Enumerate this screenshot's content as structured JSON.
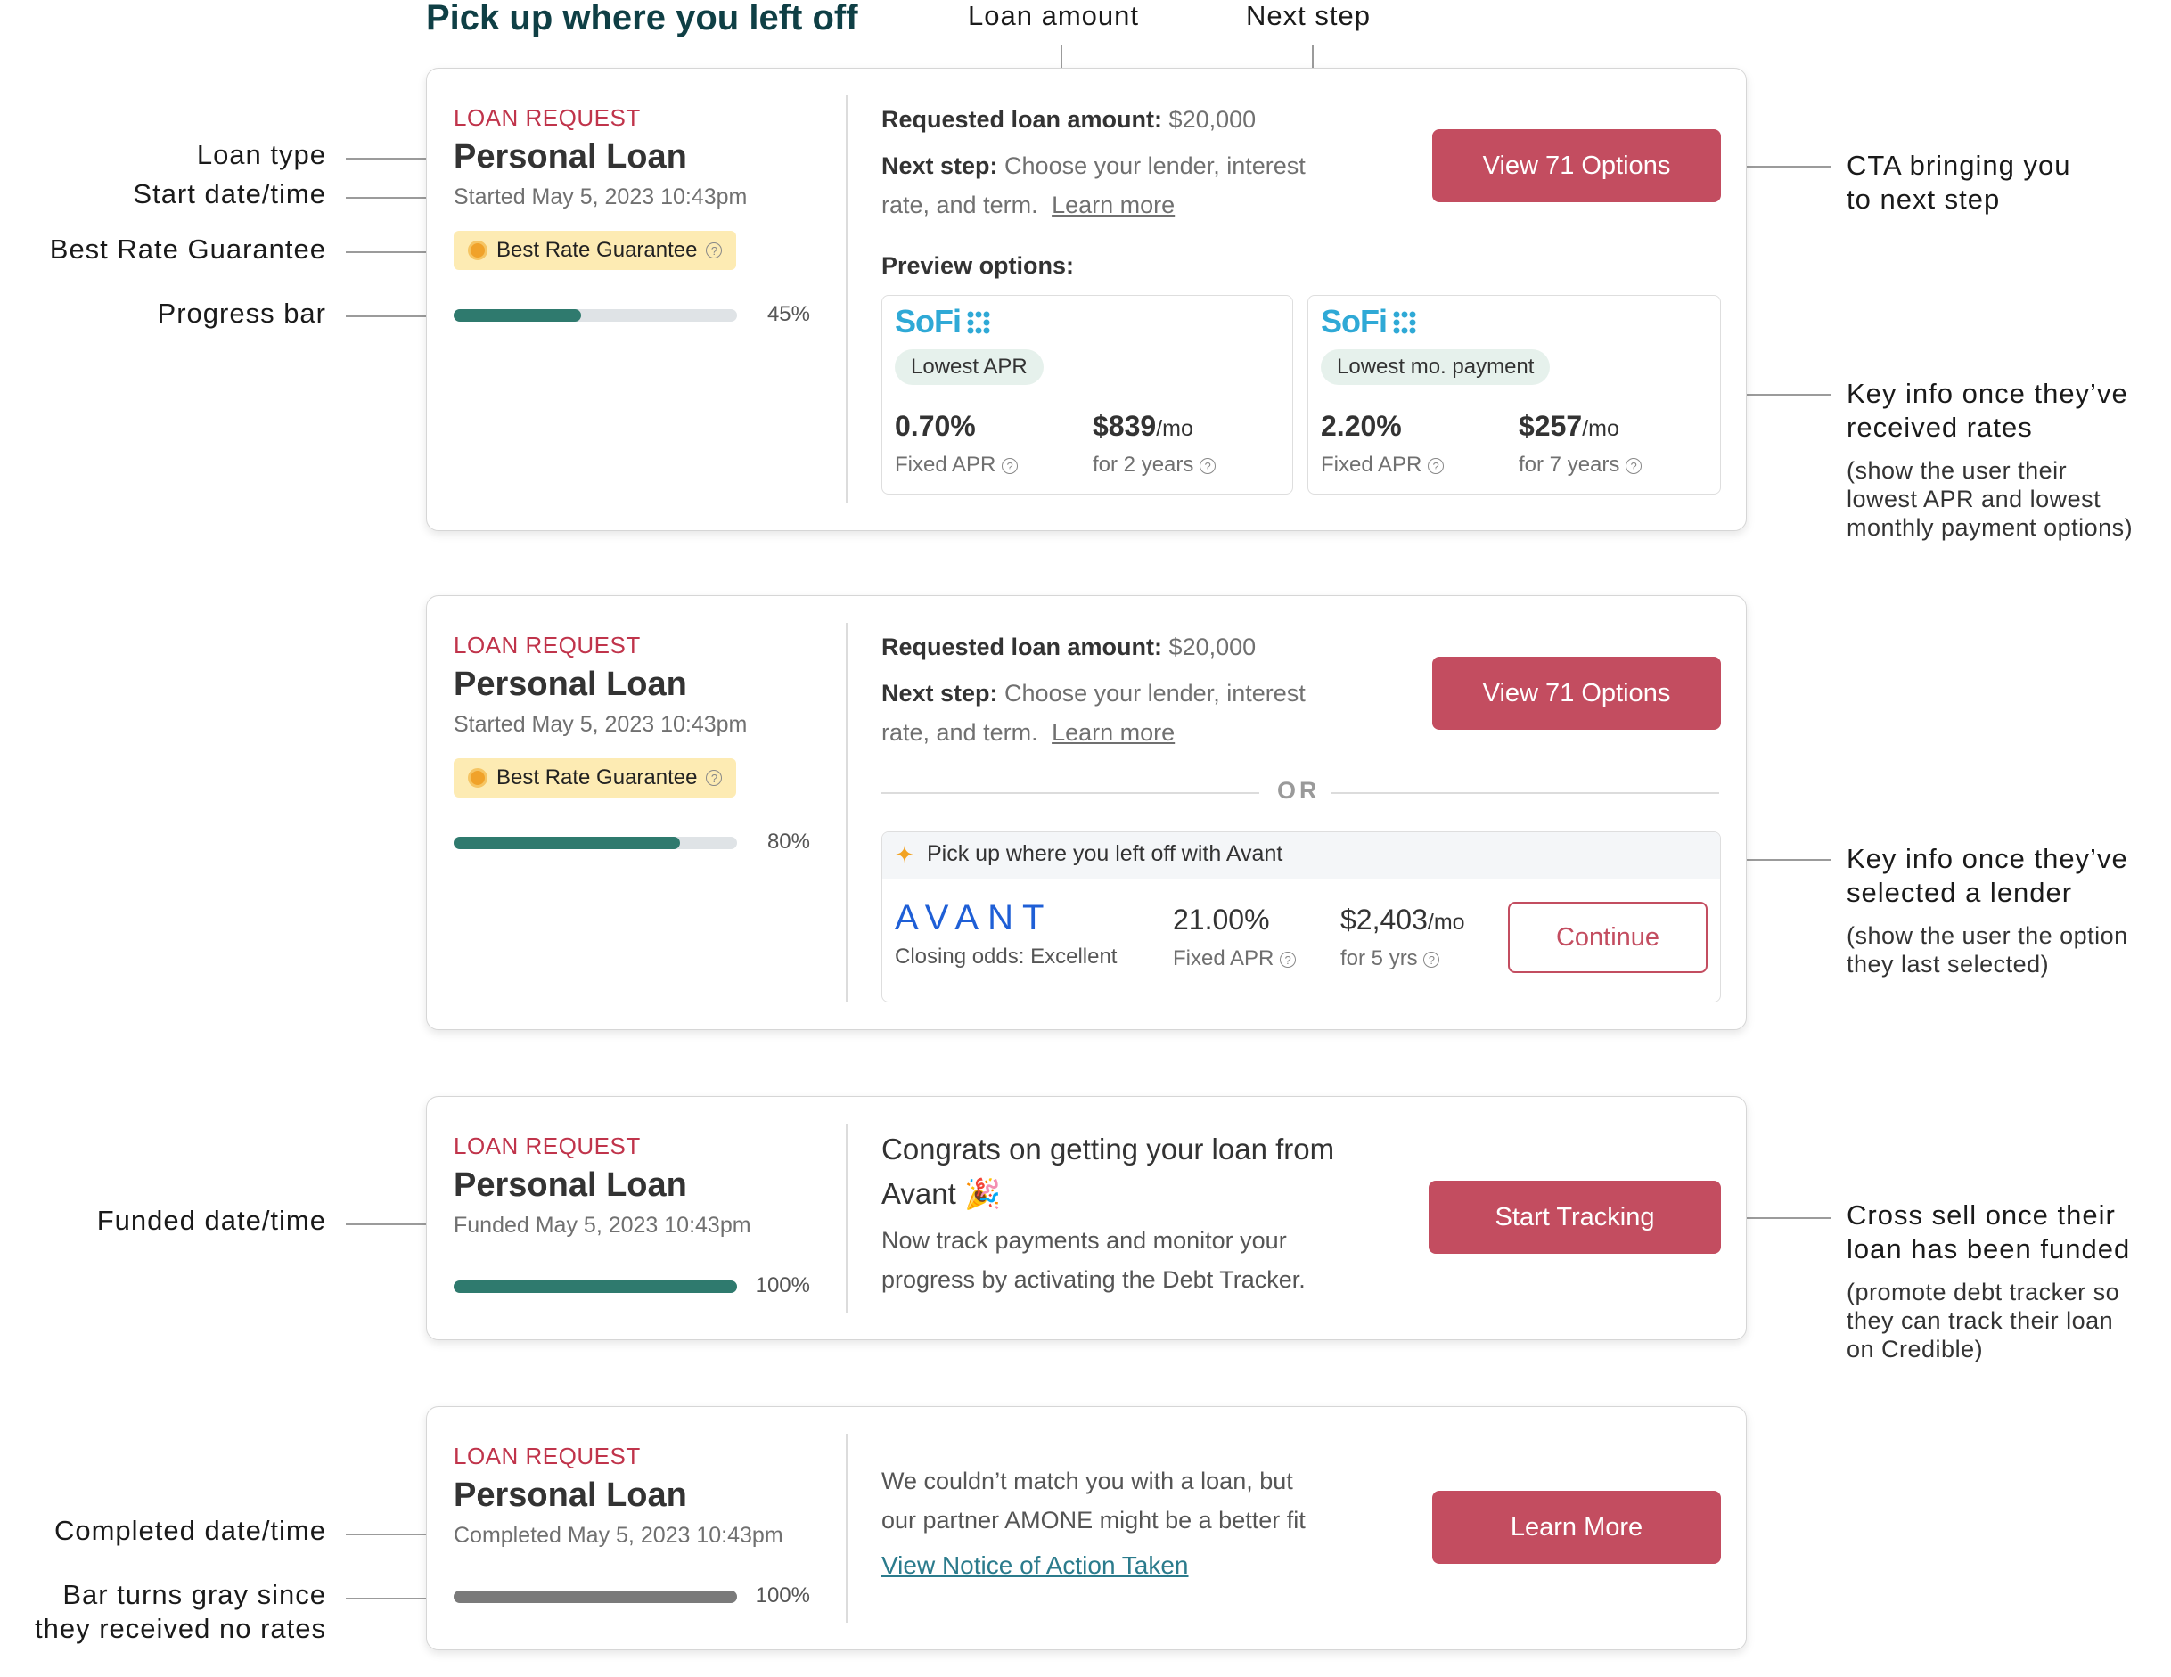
{
  "header": {
    "title": "Pick up where you left off"
  },
  "annotations": {
    "loan_amount": "Loan amount",
    "next_step": "Next step",
    "loan_type": "Loan type",
    "start_date": "Start date/time",
    "best_rate": "Best Rate Guarantee",
    "progress_bar": "Progress bar",
    "cta_line1": "CTA bringing you",
    "cta_line2": "to next step",
    "key_info_rates_line1": "Key info once they’ve",
    "key_info_rates_line2": "received rates",
    "key_info_rates_sub1": "(show the user their",
    "key_info_rates_sub2": "lowest APR and lowest",
    "key_info_rates_sub3": "monthly payment options)",
    "key_info_lender_line1": "Key info once they’ve",
    "key_info_lender_line2": "selected a lender",
    "key_info_lender_sub1": "(show the user the option",
    "key_info_lender_sub2": "they last selected)",
    "funded_date": "Funded date/time",
    "cross_sell_line1": "Cross sell once their",
    "cross_sell_line2": "loan has been funded",
    "cross_sell_sub1": "(promote debt tracker so",
    "cross_sell_sub2": "they can track their loan",
    "cross_sell_sub3": "on Credible)",
    "completed_date": "Completed date/time",
    "gray_bar_line1": "Bar turns gray since",
    "gray_bar_line2": "they received no rates"
  },
  "cards": [
    {
      "eyebrow": "LOAN REQUEST",
      "loan_type": "Personal Loan",
      "date_text": "Started May 5, 2023 10:43pm",
      "badge": "Best Rate Guarantee",
      "progress": 45,
      "progress_label": "45%",
      "amount_label": "Requested loan amount:",
      "amount_value": "$20,000",
      "next_label": "Next step:",
      "next_value": "Choose your lender, interest",
      "next_value2": "rate, and term.",
      "learn_more": "Learn more",
      "cta": "View 71 Options",
      "preview_label": "Preview options:",
      "options": [
        {
          "brand": "SoFi",
          "tag": "Lowest APR",
          "apr": "0.70%",
          "apr_label": "Fixed APR",
          "payment": "$839",
          "payment_unit": "/mo",
          "term": "for 2 years"
        },
        {
          "brand": "SoFi",
          "tag": "Lowest mo. payment",
          "apr": "2.20%",
          "apr_label": "Fixed APR",
          "payment": "$257",
          "payment_unit": "/mo",
          "term": "for 7 years"
        }
      ]
    },
    {
      "eyebrow": "LOAN REQUEST",
      "loan_type": "Personal Loan",
      "date_text": "Started May 5, 2023 10:43pm",
      "badge": "Best Rate Guarantee",
      "progress": 80,
      "progress_label": "80%",
      "amount_label": "Requested loan amount:",
      "amount_value": "$20,000",
      "next_label": "Next step:",
      "next_value": "Choose your lender, interest",
      "next_value2": "rate, and term.",
      "learn_more": "Learn more",
      "cta": "View 71 Options",
      "or_text": "OR",
      "avant": {
        "header": "Pick up where you left off with Avant",
        "logo": "AVANT",
        "odds": "Closing odds: Excellent",
        "apr": "21.00%",
        "apr_label": "Fixed APR",
        "payment": "$2,403",
        "payment_unit": "/mo",
        "term": "for 5 yrs",
        "cta": "Continue"
      }
    },
    {
      "eyebrow": "LOAN REQUEST",
      "loan_type": "Personal Loan",
      "date_text": "Funded May 5, 2023 10:43pm",
      "progress": 100,
      "progress_label": "100%",
      "congrats_line1": "Congrats on getting your loan from",
      "congrats_line2": "Avant",
      "body_line1": "Now track payments and monitor your",
      "body_line2": "progress by activating the Debt Tracker.",
      "cta": "Start Tracking"
    },
    {
      "eyebrow": "LOAN REQUEST",
      "loan_type": "Personal Loan",
      "date_text": "Completed May 5, 2023 10:43pm",
      "progress": 100,
      "progress_label": "100%",
      "body_line1": "We couldn’t match you with a loan, but",
      "body_line2": "our partner AMONE might be a better fit",
      "notice_link": "View Notice of Action Taken",
      "cta": "Learn More"
    }
  ],
  "colors": {
    "accent": "#c34d60",
    "progress": "#2f7a6e",
    "progress_gray": "#7a7a7a",
    "title": "#0f3f45",
    "badge": "#fdebb3"
  }
}
